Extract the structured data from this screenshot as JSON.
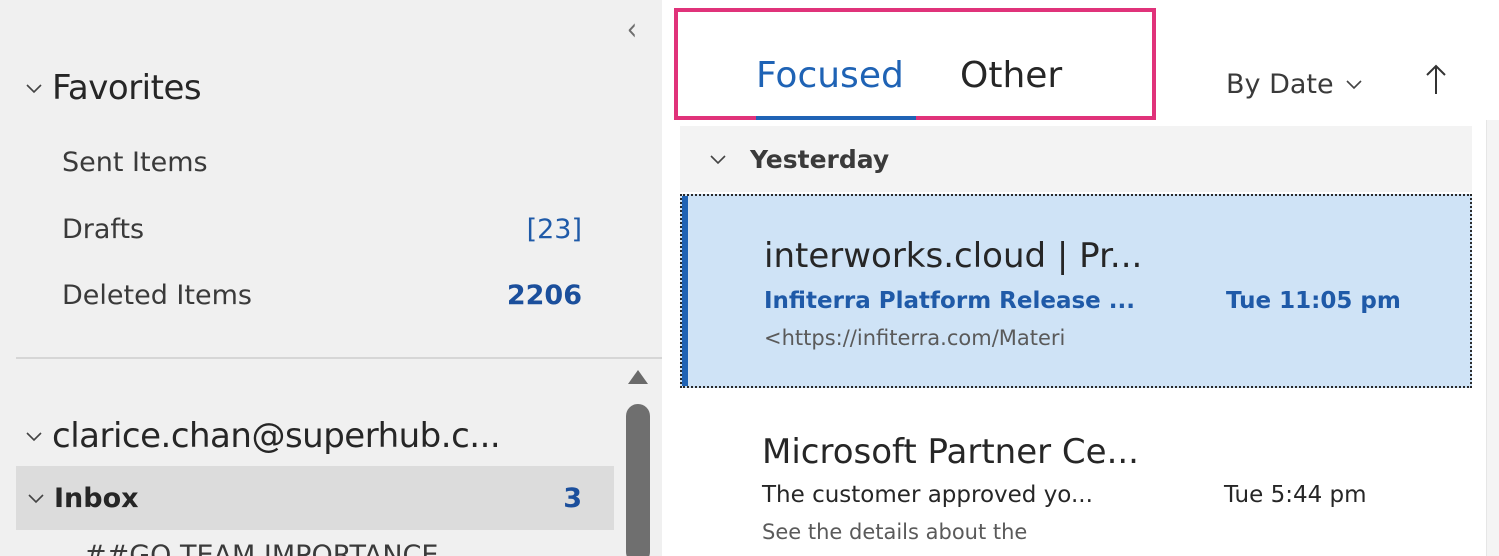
{
  "folder_pane": {
    "favorites_label": "Favorites",
    "favorites": [
      {
        "label": "Sent Items",
        "count": ""
      },
      {
        "label": "Drafts",
        "count": "[23]"
      },
      {
        "label": "Deleted Items",
        "count": "2206"
      }
    ],
    "account_label": "clarice.chan@superhub.c...",
    "inbox": {
      "label": "Inbox",
      "count": "3"
    },
    "subfolder_partial": "##GO TEAM IMPORTANCE"
  },
  "message_list": {
    "tabs": [
      {
        "label": "Focused",
        "active": true
      },
      {
        "label": "Other",
        "active": false
      }
    ],
    "sort_label": "By Date",
    "group_label": "Yesterday",
    "messages": [
      {
        "sender": "interworks.cloud | Pr...",
        "subject": "Infiterra Platform Release ...",
        "time": "Tue 11:05 pm",
        "preview": "<https://infiterra.com/Materi",
        "selected": true,
        "unread": true
      },
      {
        "sender": "Microsoft Partner Ce...",
        "subject": "The customer approved yo...",
        "time": "Tue 5:44 pm",
        "preview": "See the details about the",
        "selected": false,
        "unread": false
      }
    ]
  },
  "colors": {
    "accent_blue": "#1f63b5",
    "highlight_box": "#e0327a",
    "selected_row": "#cfe3f6",
    "folder_pane_bg": "#f0f0f0"
  }
}
